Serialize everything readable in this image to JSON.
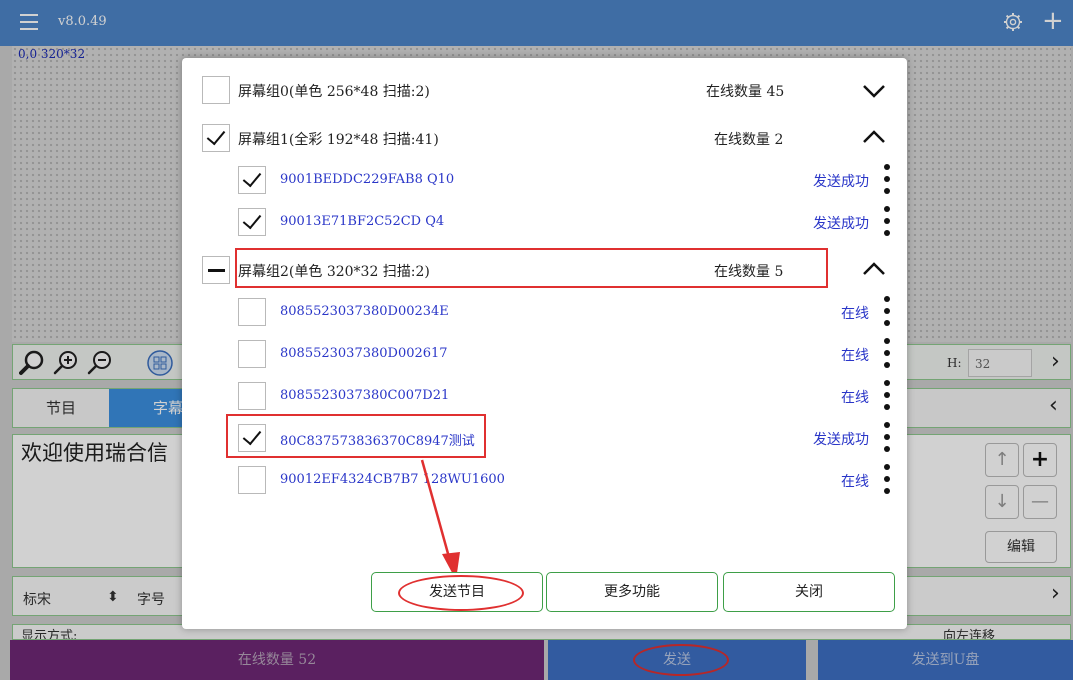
{
  "app": {
    "version": "v8.0.49",
    "coordinates": "0,0 320*32"
  },
  "icons": {
    "menu": "menu-icon",
    "settings": "gear-icon",
    "add": "plus-icon",
    "accent": "#4e86c9"
  },
  "toolbar": {
    "h_label": "H:",
    "h_value": "32"
  },
  "tabs": {
    "program": "节目",
    "caption": "字幕"
  },
  "caption": {
    "text": "欢迎使用瑞合信"
  },
  "side_buttons": {
    "edit": "编辑"
  },
  "font_row": {
    "label1": "标宋",
    "label2": "字号"
  },
  "mode_row": {
    "label": "显示方式:",
    "value": "向左连移"
  },
  "bottom": {
    "online_count": "在线数量 52",
    "send": "发送",
    "send_usb": "发送到U盘"
  },
  "dialog": {
    "groups": [
      {
        "label": "屏幕组0(单色 256*48 扫描:2)",
        "count": "在线数量 45",
        "state": "unchecked",
        "expanded": false,
        "devices": []
      },
      {
        "label": "屏幕组1(全彩 192*48 扫描:41)",
        "count": "在线数量 2",
        "state": "checked",
        "expanded": true,
        "devices": [
          {
            "id": "9001BEDDC229FAB8 Q10",
            "status": "发送成功",
            "checked": true
          },
          {
            "id": "90013E71BF2C52CD Q4",
            "status": "发送成功",
            "checked": true
          }
        ]
      },
      {
        "label": "屏幕组2(单色 320*32 扫描:2)",
        "count": "在线数量 5",
        "state": "partial",
        "expanded": true,
        "devices": [
          {
            "id": "8085523037380D00234E",
            "status": "在线",
            "checked": false
          },
          {
            "id": "8085523037380D002617",
            "status": "在线",
            "checked": false
          },
          {
            "id": "8085523037380C007D21",
            "status": "在线",
            "checked": false
          },
          {
            "id": "80C837573836370C8947测试",
            "status": "发送成功",
            "checked": true
          },
          {
            "id": "90012EF4324CB7B7 128WU1600",
            "status": "在线",
            "checked": false
          }
        ]
      }
    ],
    "buttons": {
      "send_program": "发送节目",
      "more": "更多功能",
      "close": "关闭"
    },
    "highlight_color": "#e03030"
  }
}
